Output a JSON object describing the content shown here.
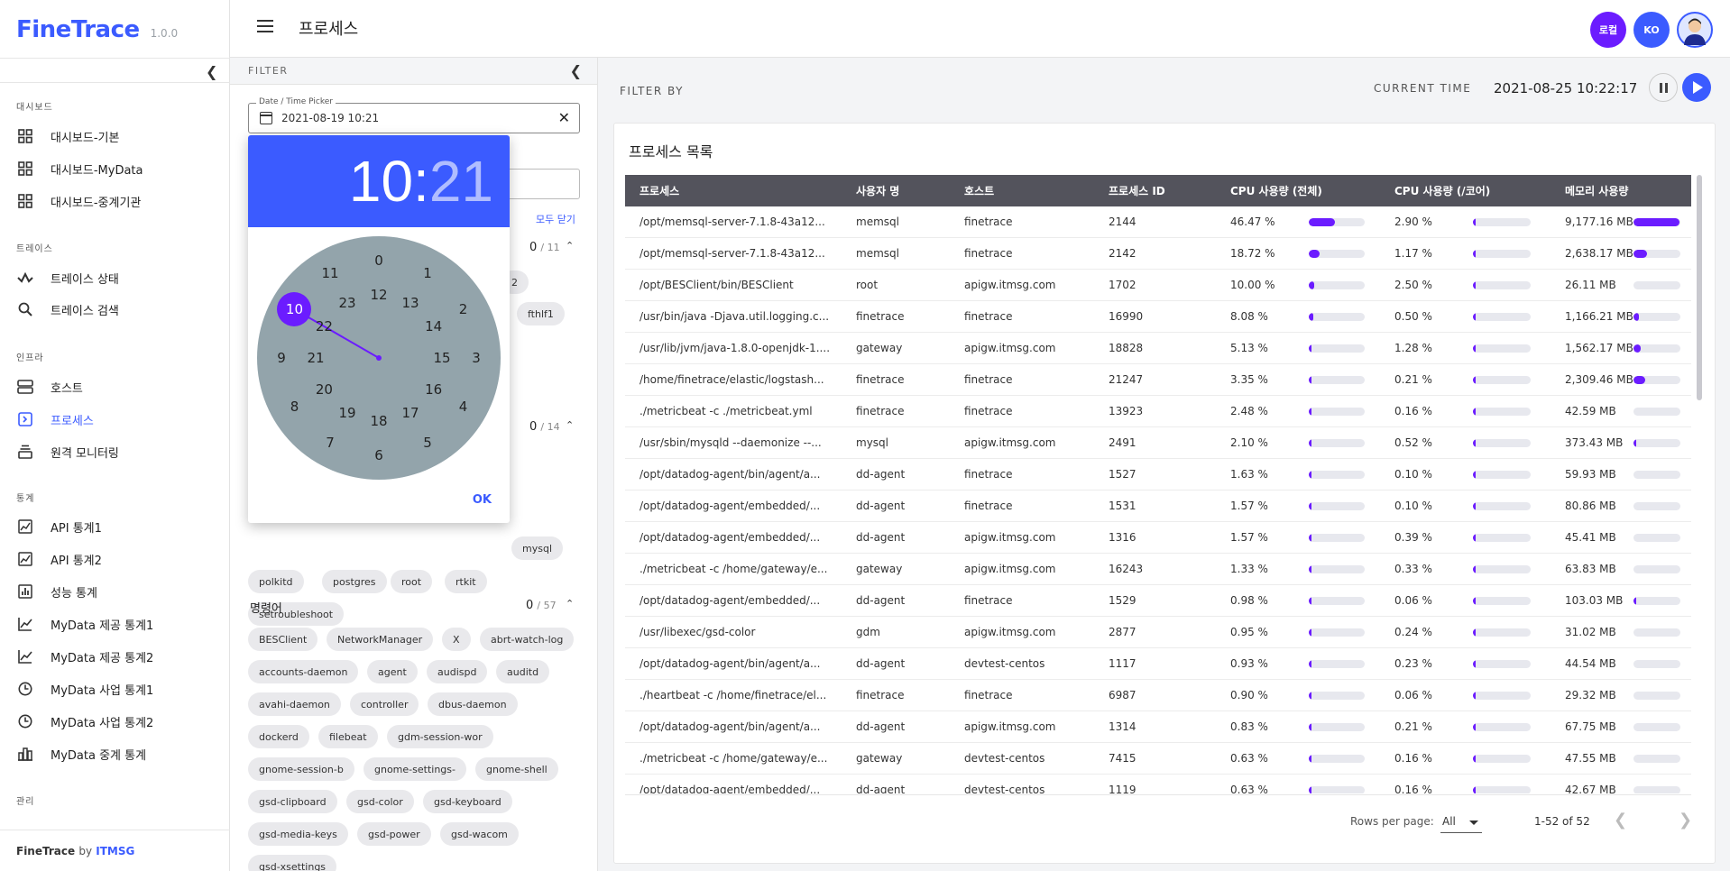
{
  "app": {
    "name": "FineTrace",
    "version": "1.0.0"
  },
  "sidebar": {
    "sections": [
      {
        "label": "대시보드",
        "items": [
          {
            "label": "대시보드-기본",
            "icon": "grid-icon"
          },
          {
            "label": "대시보드-MyData",
            "icon": "grid-icon"
          },
          {
            "label": "대시보드-중계기관",
            "icon": "grid-icon"
          }
        ]
      },
      {
        "label": "트레이스",
        "items": [
          {
            "label": "트레이스 상태",
            "icon": "pulse-icon"
          },
          {
            "label": "트레이스 검색",
            "icon": "search-icon"
          }
        ]
      },
      {
        "label": "인프라",
        "items": [
          {
            "label": "호스트",
            "icon": "server-icon"
          },
          {
            "label": "프로세스",
            "icon": "process-icon",
            "active": true
          },
          {
            "label": "원격 모니터링",
            "icon": "monitor-icon"
          }
        ]
      },
      {
        "label": "통계",
        "items": [
          {
            "label": "API 통계1",
            "icon": "chart-line-icon"
          },
          {
            "label": "API 통계2",
            "icon": "chart-line-icon"
          },
          {
            "label": "성능 통계",
            "icon": "chart-bar-icon"
          },
          {
            "label": "MyData 제공 통계1",
            "icon": "chart-trend-icon"
          },
          {
            "label": "MyData 제공 통계2",
            "icon": "chart-trend-icon"
          },
          {
            "label": "MyData 사업 통계1",
            "icon": "clock-icon"
          },
          {
            "label": "MyData 사업 통계2",
            "icon": "clock-icon"
          },
          {
            "label": "MyData 중계 통계",
            "icon": "bar-icon"
          }
        ]
      },
      {
        "label": "관리",
        "items": []
      }
    ],
    "footer": {
      "brand": "FineTrace",
      "by": "by",
      "company": "ITMSG"
    }
  },
  "topbar": {
    "title": "프로세스",
    "lang_button": "로컬",
    "ko_button": "KO"
  },
  "filter": {
    "header": "FILTER",
    "date_legend": "Date / Time Picker",
    "date_value": "2021-08-19 10:21",
    "close_all": "모두 닫기",
    "group1": {
      "count": "0",
      "total": "/ 11"
    },
    "group2": {
      "count": "0",
      "total": "/ 14"
    },
    "group3": {
      "title": "명령어",
      "count": "0",
      "total": "/ 57"
    },
    "chips_partial": [
      "2",
      "fthlf1"
    ],
    "chips_user": [
      "mysql",
      "polkitd",
      "postgres",
      "root",
      "rtkit",
      "setroubleshoot"
    ],
    "chips_cmd": [
      "BESClient",
      "NetworkManager",
      "X",
      "abrt-watch-log",
      "accounts-daemon",
      "agent",
      "audispd",
      "auditd",
      "avahi-daemon",
      "controller",
      "dbus-daemon",
      "dockerd",
      "filebeat",
      "gdm-session-wor",
      "gnome-session-b",
      "gnome-settings-",
      "gnome-shell",
      "gsd-clipboard",
      "gsd-color",
      "gsd-keyboard",
      "gsd-media-keys",
      "gsd-power",
      "gsd-wacom",
      "gsd-xsettings"
    ]
  },
  "timepicker": {
    "hour": "10",
    "sep": ":",
    "minute": "21",
    "ok": "OK",
    "outer": [
      "0",
      "1",
      "2",
      "3",
      "4",
      "5",
      "6",
      "7",
      "8",
      "9",
      "10",
      "11"
    ],
    "inner": [
      "12",
      "13",
      "14",
      "15",
      "16",
      "17",
      "18",
      "19",
      "20",
      "21",
      "22",
      "23"
    ],
    "selected": "10"
  },
  "main": {
    "filter_by": "FILTER BY",
    "current_time_label": "CURRENT TIME",
    "current_time": "2021-08-25  10:22:17",
    "card_title": "프로세스 목록",
    "columns": [
      "프로세스",
      "사용자 명",
      "호스트",
      "프로세스 ID",
      "CPU 사용량 (전체)",
      "CPU 사용량 (/코어)",
      "메모리 사용량"
    ],
    "rows": [
      {
        "proc": "/opt/memsql-server-7.1.8-43a12...",
        "user": "memsql",
        "host": "finetrace",
        "pid": "2144",
        "cpu": "46.47 %",
        "cpu_f": 0.4647,
        "core": "2.90 %",
        "core_f": 0.029,
        "mem": "9,177.16 MB",
        "mem_f": 0.98
      },
      {
        "proc": "/opt/memsql-server-7.1.8-43a12...",
        "user": "memsql",
        "host": "finetrace",
        "pid": "2142",
        "cpu": "18.72 %",
        "cpu_f": 0.1872,
        "core": "1.17 %",
        "core_f": 0.0117,
        "mem": "2,638.17 MB",
        "mem_f": 0.28
      },
      {
        "proc": "/opt/BESClient/bin/BESClient",
        "user": "root",
        "host": "apigw.itmsg.com",
        "pid": "1702",
        "cpu": "10.00 %",
        "cpu_f": 0.1,
        "core": "2.50 %",
        "core_f": 0.025,
        "mem": "26.11 MB",
        "mem_f": 0.0
      },
      {
        "proc": "/usr/bin/java -Djava.util.logging.c...",
        "user": "finetrace",
        "host": "finetrace",
        "pid": "16990",
        "cpu": "8.08 %",
        "cpu_f": 0.0808,
        "core": "0.50 %",
        "core_f": 0.005,
        "mem": "1,166.21 MB",
        "mem_f": 0.12
      },
      {
        "proc": "/usr/lib/jvm/java-1.8.0-openjdk-1....",
        "user": "gateway",
        "host": "apigw.itmsg.com",
        "pid": "18828",
        "cpu": "5.13 %",
        "cpu_f": 0.0513,
        "core": "1.28 %",
        "core_f": 0.0128,
        "mem": "1,562.17 MB",
        "mem_f": 0.16
      },
      {
        "proc": "/home/finetrace/elastic/logstash...",
        "user": "finetrace",
        "host": "finetrace",
        "pid": "21247",
        "cpu": "3.35 %",
        "cpu_f": 0.0335,
        "core": "0.21 %",
        "core_f": 0.0021,
        "mem": "2,309.46 MB",
        "mem_f": 0.25
      },
      {
        "proc": "./metricbeat -c ./metricbeat.yml",
        "user": "finetrace",
        "host": "finetrace",
        "pid": "13923",
        "cpu": "2.48 %",
        "cpu_f": 0.0248,
        "core": "0.16 %",
        "core_f": 0.0016,
        "mem": "42.59 MB",
        "mem_f": 0.0
      },
      {
        "proc": "/usr/sbin/mysqld --daemonize --...",
        "user": "mysql",
        "host": "apigw.itmsg.com",
        "pid": "2491",
        "cpu": "2.10 %",
        "cpu_f": 0.021,
        "core": "0.52 %",
        "core_f": 0.0052,
        "mem": "373.43 MB",
        "mem_f": 0.04
      },
      {
        "proc": "/opt/datadog-agent/bin/agent/a...",
        "user": "dd-agent",
        "host": "finetrace",
        "pid": "1527",
        "cpu": "1.63 %",
        "cpu_f": 0.0163,
        "core": "0.10 %",
        "core_f": 0.001,
        "mem": "59.93 MB",
        "mem_f": 0.0
      },
      {
        "proc": "/opt/datadog-agent/embedded/...",
        "user": "dd-agent",
        "host": "finetrace",
        "pid": "1531",
        "cpu": "1.57 %",
        "cpu_f": 0.0157,
        "core": "0.10 %",
        "core_f": 0.001,
        "mem": "80.86 MB",
        "mem_f": 0.0
      },
      {
        "proc": "/opt/datadog-agent/embedded/...",
        "user": "dd-agent",
        "host": "apigw.itmsg.com",
        "pid": "1316",
        "cpu": "1.57 %",
        "cpu_f": 0.0157,
        "core": "0.39 %",
        "core_f": 0.0039,
        "mem": "45.41 MB",
        "mem_f": 0.0
      },
      {
        "proc": "./metricbeat -c /home/gateway/e...",
        "user": "gateway",
        "host": "apigw.itmsg.com",
        "pid": "16243",
        "cpu": "1.33 %",
        "cpu_f": 0.0133,
        "core": "0.33 %",
        "core_f": 0.0033,
        "mem": "63.83 MB",
        "mem_f": 0.0
      },
      {
        "proc": "/opt/datadog-agent/embedded/...",
        "user": "dd-agent",
        "host": "finetrace",
        "pid": "1529",
        "cpu": "0.98 %",
        "cpu_f": 0.0098,
        "core": "0.06 %",
        "core_f": 0.0006,
        "mem": "103.03 MB",
        "mem_f": 0.01
      },
      {
        "proc": "/usr/libexec/gsd-color",
        "user": "gdm",
        "host": "apigw.itmsg.com",
        "pid": "2877",
        "cpu": "0.95 %",
        "cpu_f": 0.0095,
        "core": "0.24 %",
        "core_f": 0.0024,
        "mem": "31.02 MB",
        "mem_f": 0.0
      },
      {
        "proc": "/opt/datadog-agent/bin/agent/a...",
        "user": "dd-agent",
        "host": "devtest-centos",
        "pid": "1117",
        "cpu": "0.93 %",
        "cpu_f": 0.0093,
        "core": "0.23 %",
        "core_f": 0.0023,
        "mem": "44.54 MB",
        "mem_f": 0.0
      },
      {
        "proc": "./heartbeat -c /home/finetrace/el...",
        "user": "finetrace",
        "host": "finetrace",
        "pid": "6987",
        "cpu": "0.90 %",
        "cpu_f": 0.009,
        "core": "0.06 %",
        "core_f": 0.0006,
        "mem": "29.32 MB",
        "mem_f": 0.0
      },
      {
        "proc": "/opt/datadog-agent/bin/agent/a...",
        "user": "dd-agent",
        "host": "apigw.itmsg.com",
        "pid": "1314",
        "cpu": "0.83 %",
        "cpu_f": 0.0083,
        "core": "0.21 %",
        "core_f": 0.0021,
        "mem": "67.75 MB",
        "mem_f": 0.0
      },
      {
        "proc": "./metricbeat -c /home/gateway/e...",
        "user": "gateway",
        "host": "devtest-centos",
        "pid": "7415",
        "cpu": "0.63 %",
        "cpu_f": 0.0063,
        "core": "0.16 %",
        "core_f": 0.0016,
        "mem": "47.55 MB",
        "mem_f": 0.0
      },
      {
        "proc": "/opt/datadog-agent/embedded/...",
        "user": "dd-agent",
        "host": "devtest-centos",
        "pid": "1119",
        "cpu": "0.63 %",
        "cpu_f": 0.0063,
        "core": "0.16 %",
        "core_f": 0.0016,
        "mem": "42.67 MB",
        "mem_f": 0.0
      }
    ],
    "pager": {
      "rows_per_page_label": "Rows per page:",
      "rows_per_page_value": "All",
      "range": "1-52 of 52"
    }
  },
  "colors": {
    "accent": "#3b5bff",
    "purple": "#6b1cff",
    "header_dark": "#53535c",
    "clock_face": "#93a4ab"
  }
}
